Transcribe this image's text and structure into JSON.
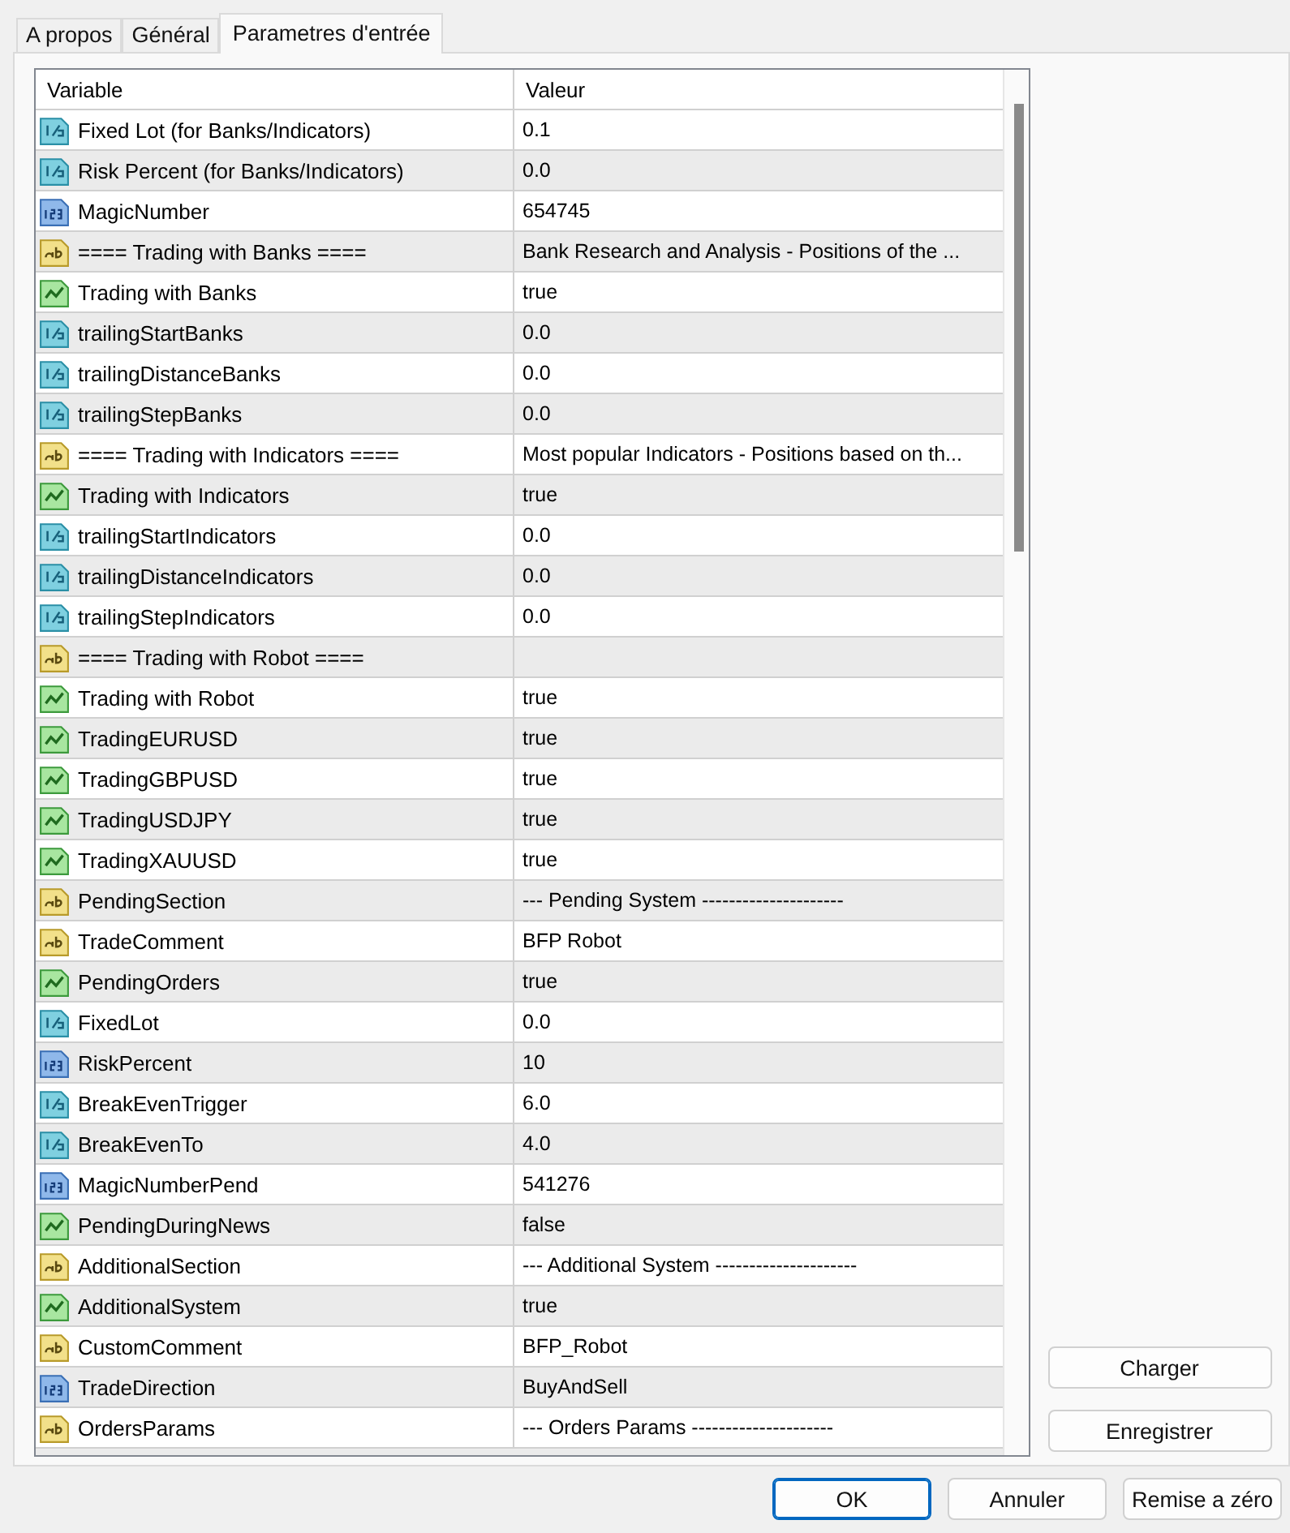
{
  "tabs": [
    {
      "label": "A propos",
      "selected": false
    },
    {
      "label": "Général",
      "selected": false
    },
    {
      "label": "Parametres d'entrée",
      "selected": true
    }
  ],
  "table": {
    "columns": [
      "Variable",
      "Valeur"
    ],
    "rows": [
      {
        "kind": "double",
        "variable": "Fixed Lot (for Banks/Indicators)",
        "value": "0.1"
      },
      {
        "kind": "double",
        "variable": "Risk Percent (for Banks/Indicators)",
        "value": "0.0"
      },
      {
        "kind": "int",
        "variable": "MagicNumber",
        "value": "654745"
      },
      {
        "kind": "string",
        "variable": "====  Trading with Banks ====",
        "value": "Bank Research and Analysis - Positions of the ..."
      },
      {
        "kind": "bool",
        "variable": "Trading with Banks",
        "value": "true"
      },
      {
        "kind": "double",
        "variable": "trailingStartBanks",
        "value": "0.0"
      },
      {
        "kind": "double",
        "variable": "trailingDistanceBanks",
        "value": "0.0"
      },
      {
        "kind": "double",
        "variable": "trailingStepBanks",
        "value": "0.0"
      },
      {
        "kind": "string",
        "variable": "==== Trading with Indicators ====",
        "value": "Most popular Indicators - Positions based on th..."
      },
      {
        "kind": "bool",
        "variable": "Trading with Indicators",
        "value": "true"
      },
      {
        "kind": "double",
        "variable": "trailingStartIndicators",
        "value": "0.0"
      },
      {
        "kind": "double",
        "variable": "trailingDistanceIndicators",
        "value": "0.0"
      },
      {
        "kind": "double",
        "variable": "trailingStepIndicators",
        "value": "0.0"
      },
      {
        "kind": "string",
        "variable": "==== Trading with Robot ===="
      },
      {
        "kind": "bool",
        "variable": "Trading with Robot",
        "value": "true"
      },
      {
        "kind": "bool",
        "variable": "TradingEURUSD",
        "value": "true"
      },
      {
        "kind": "bool",
        "variable": "TradingGBPUSD",
        "value": "true"
      },
      {
        "kind": "bool",
        "variable": "TradingUSDJPY",
        "value": "true"
      },
      {
        "kind": "bool",
        "variable": "TradingXAUUSD",
        "value": "true"
      },
      {
        "kind": "string",
        "variable": "PendingSection",
        "value": "--- Pending System ---------------------"
      },
      {
        "kind": "string",
        "variable": "TradeComment",
        "value": "BFP Robot"
      },
      {
        "kind": "bool",
        "variable": "PendingOrders",
        "value": "true"
      },
      {
        "kind": "double",
        "variable": "FixedLot",
        "value": "0.0"
      },
      {
        "kind": "int",
        "variable": "RiskPercent",
        "value": "10"
      },
      {
        "kind": "double",
        "variable": "BreakEvenTrigger",
        "value": "6.0"
      },
      {
        "kind": "double",
        "variable": "BreakEvenTo",
        "value": "4.0"
      },
      {
        "kind": "int",
        "variable": "MagicNumberPend",
        "value": "541276"
      },
      {
        "kind": "bool",
        "variable": "PendingDuringNews",
        "value": "false"
      },
      {
        "kind": "string",
        "variable": "AdditionalSection",
        "value": "--- Additional System ---------------------"
      },
      {
        "kind": "bool",
        "variable": "AdditionalSystem",
        "value": "true"
      },
      {
        "kind": "string",
        "variable": "CustomComment",
        "value": "BFP_Robot"
      },
      {
        "kind": "int",
        "variable": "TradeDirection",
        "value": "BuyAndSell"
      },
      {
        "kind": "string",
        "variable": "OrdersParams",
        "value": "--- Orders Params ---------------------"
      }
    ]
  },
  "side_buttons": [
    "Charger",
    "Enregistrer"
  ],
  "buttons": [
    {
      "label": "OK",
      "default": true
    },
    {
      "label": "Annuler",
      "default": false
    },
    {
      "label": "Remise a zéro",
      "default": false
    }
  ]
}
